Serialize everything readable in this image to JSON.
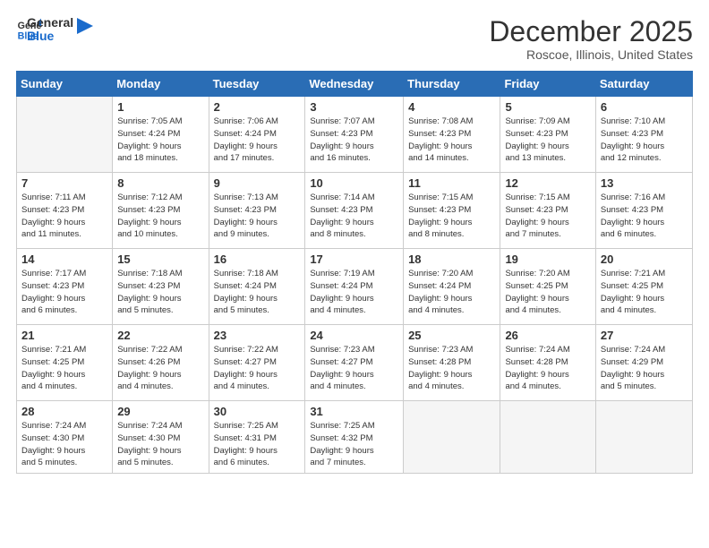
{
  "header": {
    "logo_line1": "General",
    "logo_line2": "Blue",
    "month": "December 2025",
    "location": "Roscoe, Illinois, United States"
  },
  "weekdays": [
    "Sunday",
    "Monday",
    "Tuesday",
    "Wednesday",
    "Thursday",
    "Friday",
    "Saturday"
  ],
  "weeks": [
    [
      {
        "day": "",
        "info": ""
      },
      {
        "day": "1",
        "info": "Sunrise: 7:05 AM\nSunset: 4:24 PM\nDaylight: 9 hours\nand 18 minutes."
      },
      {
        "day": "2",
        "info": "Sunrise: 7:06 AM\nSunset: 4:24 PM\nDaylight: 9 hours\nand 17 minutes."
      },
      {
        "day": "3",
        "info": "Sunrise: 7:07 AM\nSunset: 4:23 PM\nDaylight: 9 hours\nand 16 minutes."
      },
      {
        "day": "4",
        "info": "Sunrise: 7:08 AM\nSunset: 4:23 PM\nDaylight: 9 hours\nand 14 minutes."
      },
      {
        "day": "5",
        "info": "Sunrise: 7:09 AM\nSunset: 4:23 PM\nDaylight: 9 hours\nand 13 minutes."
      },
      {
        "day": "6",
        "info": "Sunrise: 7:10 AM\nSunset: 4:23 PM\nDaylight: 9 hours\nand 12 minutes."
      }
    ],
    [
      {
        "day": "7",
        "info": "Sunrise: 7:11 AM\nSunset: 4:23 PM\nDaylight: 9 hours\nand 11 minutes."
      },
      {
        "day": "8",
        "info": "Sunrise: 7:12 AM\nSunset: 4:23 PM\nDaylight: 9 hours\nand 10 minutes."
      },
      {
        "day": "9",
        "info": "Sunrise: 7:13 AM\nSunset: 4:23 PM\nDaylight: 9 hours\nand 9 minutes."
      },
      {
        "day": "10",
        "info": "Sunrise: 7:14 AM\nSunset: 4:23 PM\nDaylight: 9 hours\nand 8 minutes."
      },
      {
        "day": "11",
        "info": "Sunrise: 7:15 AM\nSunset: 4:23 PM\nDaylight: 9 hours\nand 8 minutes."
      },
      {
        "day": "12",
        "info": "Sunrise: 7:15 AM\nSunset: 4:23 PM\nDaylight: 9 hours\nand 7 minutes."
      },
      {
        "day": "13",
        "info": "Sunrise: 7:16 AM\nSunset: 4:23 PM\nDaylight: 9 hours\nand 6 minutes."
      }
    ],
    [
      {
        "day": "14",
        "info": "Sunrise: 7:17 AM\nSunset: 4:23 PM\nDaylight: 9 hours\nand 6 minutes."
      },
      {
        "day": "15",
        "info": "Sunrise: 7:18 AM\nSunset: 4:23 PM\nDaylight: 9 hours\nand 5 minutes."
      },
      {
        "day": "16",
        "info": "Sunrise: 7:18 AM\nSunset: 4:24 PM\nDaylight: 9 hours\nand 5 minutes."
      },
      {
        "day": "17",
        "info": "Sunrise: 7:19 AM\nSunset: 4:24 PM\nDaylight: 9 hours\nand 4 minutes."
      },
      {
        "day": "18",
        "info": "Sunrise: 7:20 AM\nSunset: 4:24 PM\nDaylight: 9 hours\nand 4 minutes."
      },
      {
        "day": "19",
        "info": "Sunrise: 7:20 AM\nSunset: 4:25 PM\nDaylight: 9 hours\nand 4 minutes."
      },
      {
        "day": "20",
        "info": "Sunrise: 7:21 AM\nSunset: 4:25 PM\nDaylight: 9 hours\nand 4 minutes."
      }
    ],
    [
      {
        "day": "21",
        "info": "Sunrise: 7:21 AM\nSunset: 4:25 PM\nDaylight: 9 hours\nand 4 minutes."
      },
      {
        "day": "22",
        "info": "Sunrise: 7:22 AM\nSunset: 4:26 PM\nDaylight: 9 hours\nand 4 minutes."
      },
      {
        "day": "23",
        "info": "Sunrise: 7:22 AM\nSunset: 4:27 PM\nDaylight: 9 hours\nand 4 minutes."
      },
      {
        "day": "24",
        "info": "Sunrise: 7:23 AM\nSunset: 4:27 PM\nDaylight: 9 hours\nand 4 minutes."
      },
      {
        "day": "25",
        "info": "Sunrise: 7:23 AM\nSunset: 4:28 PM\nDaylight: 9 hours\nand 4 minutes."
      },
      {
        "day": "26",
        "info": "Sunrise: 7:24 AM\nSunset: 4:28 PM\nDaylight: 9 hours\nand 4 minutes."
      },
      {
        "day": "27",
        "info": "Sunrise: 7:24 AM\nSunset: 4:29 PM\nDaylight: 9 hours\nand 5 minutes."
      }
    ],
    [
      {
        "day": "28",
        "info": "Sunrise: 7:24 AM\nSunset: 4:30 PM\nDaylight: 9 hours\nand 5 minutes."
      },
      {
        "day": "29",
        "info": "Sunrise: 7:24 AM\nSunset: 4:30 PM\nDaylight: 9 hours\nand 5 minutes."
      },
      {
        "day": "30",
        "info": "Sunrise: 7:25 AM\nSunset: 4:31 PM\nDaylight: 9 hours\nand 6 minutes."
      },
      {
        "day": "31",
        "info": "Sunrise: 7:25 AM\nSunset: 4:32 PM\nDaylight: 9 hours\nand 7 minutes."
      },
      {
        "day": "",
        "info": ""
      },
      {
        "day": "",
        "info": ""
      },
      {
        "day": "",
        "info": ""
      }
    ]
  ]
}
